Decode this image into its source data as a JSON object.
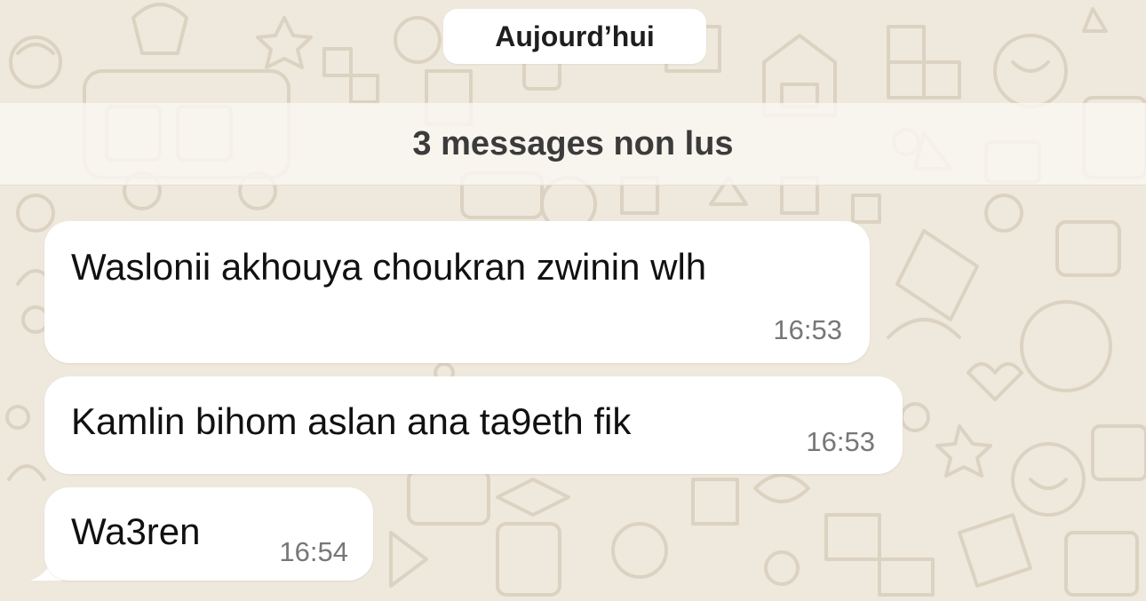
{
  "chat": {
    "date_separator": "Aujourd’hui",
    "unread_banner": "3 messages non lus",
    "messages": [
      {
        "text": "Waslonii akhouya choukran zwinin wlh",
        "time": "16:53"
      },
      {
        "text": "Kamlin bihom aslan ana ta9eth fik",
        "time": "16:53"
      },
      {
        "text": "Wa3ren",
        "time": "16:54"
      }
    ]
  },
  "colors": {
    "wallpaper": "#efe8dc",
    "wallpaper_doodle": "#d9cfbf",
    "bubble": "#ffffff",
    "timestamp": "#777777",
    "banner_text": "#3b3b3b"
  }
}
